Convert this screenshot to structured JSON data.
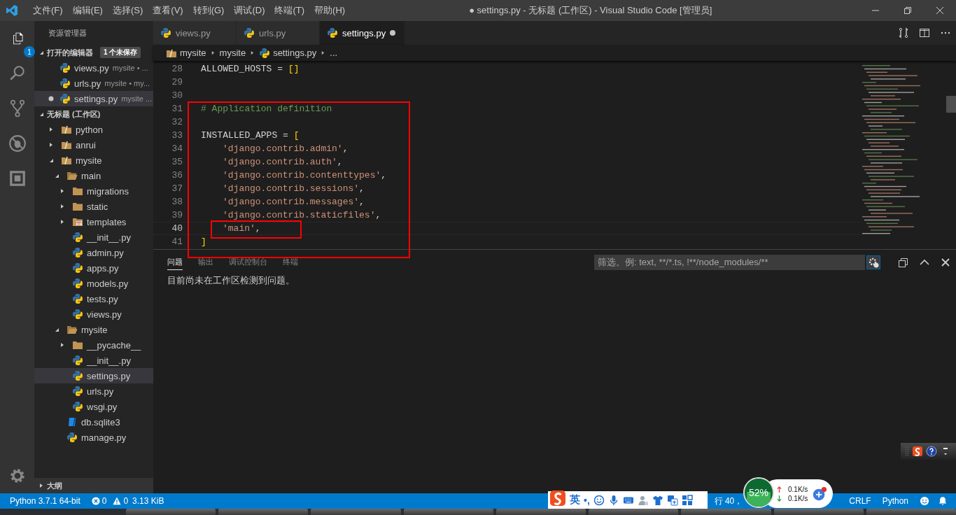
{
  "window": {
    "title": "● settings.py - 无标题 (工作区) - Visual Studio Code [管理员]"
  },
  "menu": [
    "文件(F)",
    "编辑(E)",
    "选择(S)",
    "查看(V)",
    "转到(G)",
    "调试(D)",
    "终端(T)",
    "帮助(H)"
  ],
  "activity_bar": {
    "explorer_badge": "1"
  },
  "sidebar": {
    "title": "资源管理器",
    "open_editors": {
      "label": "打开的编辑器",
      "badge": "1 个未保存",
      "expanded": true,
      "items": [
        {
          "name": "views.py",
          "detail": "mysite • ...",
          "dirty": false,
          "selected": false
        },
        {
          "name": "urls.py",
          "detail": "mysite • my...",
          "dirty": false,
          "selected": false
        },
        {
          "name": "settings.py",
          "detail": "mysite ...",
          "dirty": true,
          "selected": true
        }
      ]
    },
    "workspace": {
      "label": "无标题 (工作区)",
      "expanded": true,
      "tree": [
        {
          "name": "python",
          "kind": "root",
          "expanded": false,
          "selected": false
        },
        {
          "name": "anrui",
          "kind": "root",
          "expanded": false,
          "selected": false
        },
        {
          "name": "mysite",
          "kind": "root",
          "expanded": true,
          "selected": false,
          "children": [
            {
              "name": "main",
              "kind": "folder",
              "expanded": true,
              "selected": false,
              "children": [
                {
                  "name": "migrations",
                  "kind": "folder",
                  "expanded": false,
                  "selected": false
                },
                {
                  "name": "static",
                  "kind": "folder",
                  "expanded": false,
                  "selected": false
                },
                {
                  "name": "templates",
                  "kind": "templates",
                  "expanded": false,
                  "selected": false
                },
                {
                  "name": "__init__.py",
                  "kind": "python",
                  "selected": false
                },
                {
                  "name": "admin.py",
                  "kind": "python",
                  "selected": false
                },
                {
                  "name": "apps.py",
                  "kind": "python",
                  "selected": false
                },
                {
                  "name": "models.py",
                  "kind": "python",
                  "selected": false
                },
                {
                  "name": "tests.py",
                  "kind": "python",
                  "selected": false
                },
                {
                  "name": "views.py",
                  "kind": "python",
                  "selected": false
                }
              ]
            },
            {
              "name": "mysite",
              "kind": "folder",
              "expanded": true,
              "selected": false,
              "children": [
                {
                  "name": "__pycache__",
                  "kind": "folder",
                  "expanded": false,
                  "selected": false
                },
                {
                  "name": "__init__.py",
                  "kind": "python",
                  "selected": false
                },
                {
                  "name": "settings.py",
                  "kind": "python",
                  "selected": true
                },
                {
                  "name": "urls.py",
                  "kind": "python",
                  "selected": false
                },
                {
                  "name": "wsgi.py",
                  "kind": "python",
                  "selected": false
                }
              ]
            },
            {
              "name": "db.sqlite3",
              "kind": "database",
              "selected": false
            },
            {
              "name": "manage.py",
              "kind": "python",
              "selected": false
            }
          ]
        }
      ]
    },
    "outline": {
      "label": "大纲",
      "expanded": false
    }
  },
  "tabs": [
    {
      "label": "views.py",
      "selected": false,
      "dirty": false
    },
    {
      "label": "urls.py",
      "selected": false,
      "dirty": false
    },
    {
      "label": "settings.py",
      "selected": true,
      "dirty": true
    }
  ],
  "breadcrumb": [
    {
      "label": "mysite",
      "kind": "root"
    },
    {
      "label": "mysite",
      "kind": "plain"
    },
    {
      "label": "settings.py",
      "kind": "python"
    },
    {
      "label": "...",
      "kind": "plain"
    }
  ],
  "code": [
    {
      "number": "28",
      "current": false,
      "kind": "statement",
      "tokens": [
        {
          "kind": "name",
          "text": "ALLOWED_HOSTS"
        },
        {
          "kind": "op",
          "text": " = "
        },
        {
          "kind": "bracket",
          "text": "[]"
        }
      ]
    },
    {
      "number": "29",
      "current": false,
      "kind": "blank"
    },
    {
      "number": "30",
      "current": false,
      "kind": "blank"
    },
    {
      "number": "31",
      "current": false,
      "kind": "statement",
      "tokens": [
        {
          "kind": "comment",
          "text": "# Application definition"
        }
      ]
    },
    {
      "number": "32",
      "current": false,
      "kind": "blank"
    },
    {
      "number": "33",
      "current": false,
      "kind": "statement",
      "tokens": [
        {
          "kind": "name",
          "text": "INSTALLED_APPS"
        },
        {
          "kind": "op",
          "text": " = "
        },
        {
          "kind": "bracket",
          "text": "["
        }
      ]
    },
    {
      "number": "34",
      "current": false,
      "kind": "item",
      "tokens": [
        {
          "kind": "string",
          "text": "'django.contrib.admin'"
        },
        {
          "kind": "op",
          "text": ","
        }
      ]
    },
    {
      "number": "35",
      "current": false,
      "kind": "item",
      "tokens": [
        {
          "kind": "string",
          "text": "'django.contrib.auth'"
        },
        {
          "kind": "op",
          "text": ","
        }
      ]
    },
    {
      "number": "36",
      "current": false,
      "kind": "item",
      "tokens": [
        {
          "kind": "string",
          "text": "'django.contrib.contenttypes'"
        },
        {
          "kind": "op",
          "text": ","
        }
      ]
    },
    {
      "number": "37",
      "current": false,
      "kind": "item",
      "tokens": [
        {
          "kind": "string",
          "text": "'django.contrib.sessions'"
        },
        {
          "kind": "op",
          "text": ","
        }
      ]
    },
    {
      "number": "38",
      "current": false,
      "kind": "item",
      "tokens": [
        {
          "kind": "string",
          "text": "'django.contrib.messages'"
        },
        {
          "kind": "op",
          "text": ","
        }
      ]
    },
    {
      "number": "39",
      "current": false,
      "kind": "item",
      "tokens": [
        {
          "kind": "string",
          "text": "'django.contrib.staticfiles'"
        },
        {
          "kind": "op",
          "text": ","
        }
      ]
    },
    {
      "number": "40",
      "current": true,
      "kind": "item",
      "tokens": [
        {
          "kind": "string",
          "text": "'main'"
        },
        {
          "kind": "op",
          "text": ","
        }
      ]
    },
    {
      "number": "41",
      "current": false,
      "kind": "statement",
      "tokens": [
        {
          "kind": "bracket",
          "text": "]"
        }
      ]
    }
  ],
  "panel": {
    "tabs": [
      {
        "label": "问题",
        "selected": true
      },
      {
        "label": "输出",
        "selected": false
      },
      {
        "label": "调试控制台",
        "selected": false
      },
      {
        "label": "终端",
        "selected": false
      }
    ],
    "filter": {
      "placeholder": "筛选。例: text, **/*.ts, !**/node_modules/**"
    },
    "message": "目前尚未在工作区检测到问题。"
  },
  "status_bar": {
    "interpreter": "Python 3.7.1 64-bit",
    "errors": "0",
    "warnings": "0",
    "file_size": "3.13 KiB",
    "position": "行 40，",
    "line_ending": "CRLF",
    "language": "Python"
  },
  "ime_bar": {
    "mode": "英",
    "punctuation": "•,"
  },
  "speed_widget": {
    "load": "52%",
    "level": 0.52,
    "upload": "0.1K/s",
    "download": "0.1K/s"
  }
}
